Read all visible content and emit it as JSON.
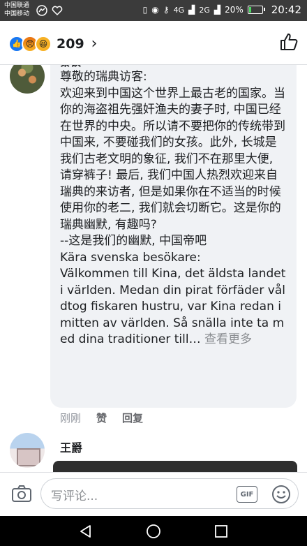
{
  "status_bar": {
    "carrier_1": "中国联通",
    "carrier_2": "中国移动",
    "network_1": "4G",
    "network_2": "2G",
    "battery": "20%",
    "time": "20:42",
    "battery_level": 0.2,
    "battery_color": "#4cd964"
  },
  "header": {
    "reaction_icons": [
      "like-icon",
      "angry-icon",
      "haha-icon"
    ],
    "reaction_count": "209",
    "chevron": "›",
    "like_button_icon": "thumbs-up-icon"
  },
  "comments": [
    {
      "author": "秦钗",
      "text": "尊敬的瑞典访客:\n欢迎来到中国这个世界上最古老的国家。当你的海盗祖先强奸渔夫的妻子时, 中国已经在世界的中央。所以请不要把你的传统带到中国来, 不要碰我们的女孩。此外, 长城是我们古老文明的象征, 我们不在那里大便, 请穿裤子! 最后, 我们中国人热烈欢迎来自瑞典的来访者, 但是如果你在不适当的时候使用你的老二, 我们就会切断它。这是你的瑞典幽默, 有趣吗?\n--这是我们的幽默, 中国帝吧\nKära svenska besökare:\nVälkommen till Kina, det äldsta landet i världen. Medan din pirat förfäder våldtog fiskaren hustru, var Kina redan i mitten av världen. Så snälla inte ta med dina traditioner till…",
      "see_more": "查看更多",
      "time": "刚刚",
      "like": "赞",
      "reply": "回复"
    },
    {
      "author": "王爵"
    }
  ],
  "composer": {
    "placeholder": "写评论...",
    "gif": "GIF"
  },
  "colors": {
    "accent": "#1877f2",
    "bubble": "#f0f2f5",
    "muted": "#8a8d91"
  }
}
